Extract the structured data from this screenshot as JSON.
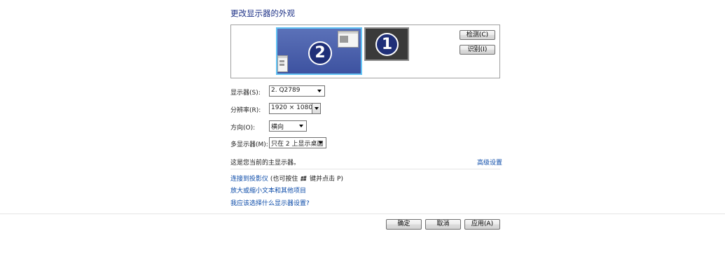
{
  "title": "更改显示器的外观",
  "monitors": [
    {
      "number": "2",
      "selected": true
    },
    {
      "number": "1",
      "selected": false
    }
  ],
  "buttons": {
    "detect": "检测(C)",
    "identify": "识别(I)",
    "ok": "确定",
    "cancel": "取消",
    "apply": "应用(A)"
  },
  "fields": {
    "display": {
      "label": "显示器(S):",
      "value": "2. Q2789"
    },
    "resolution": {
      "label": "分辨率(R):",
      "value": "1920 × 1080"
    },
    "orientation": {
      "label": "方向(O):",
      "value": "横向"
    },
    "multiple_displays": {
      "label": "多显示器(M):",
      "value": "只在 2 上显示桌面"
    }
  },
  "main_display_note": "这是您当前的主显示器。",
  "advanced_settings_link": "高级设置",
  "links": {
    "projector": "连接到投影仪",
    "projector_hint_pre": "(也可按住",
    "projector_hint_post": "键并点击 P)",
    "text_size": "放大或缩小文本和其他项目",
    "which_setting": "我应该选择什么显示器设置?"
  },
  "icons": {
    "windows_key": "windows-logo-icon",
    "dropdown": "chevron-down-icon"
  },
  "colors": {
    "title": "#1e3287",
    "link": "#0a4aa8",
    "selected_monitor": "#3d52a0",
    "selected_border": "#62c2f3",
    "unselected_monitor": "#3a3a3a"
  }
}
